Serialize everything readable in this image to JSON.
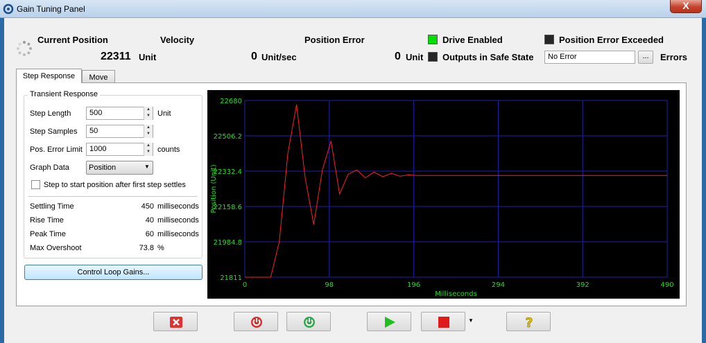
{
  "window": {
    "title": "Gain Tuning Panel",
    "close_label": "X"
  },
  "status": {
    "current_position_label": "Current Position",
    "current_position_value": "22311",
    "current_position_unit": "Unit",
    "velocity_label": "Velocity",
    "velocity_value": "0",
    "velocity_unit": "Unit/sec",
    "position_error_label": "Position Error",
    "position_error_value": "0",
    "position_error_unit": "Unit",
    "drive_enabled_label": "Drive Enabled",
    "drive_enabled_color": "#00e000",
    "safe_state_label": "Outputs in Safe State",
    "safe_state_color": "#262626",
    "pos_error_exceeded_label": "Position Error Exceeded",
    "pos_error_exceeded_color": "#262626",
    "errors_value": "No Error",
    "errors_browse_label": "...",
    "errors_label": "Errors"
  },
  "tabs": [
    {
      "label": "Step Response",
      "active": true
    },
    {
      "label": "Move",
      "active": false
    }
  ],
  "transient": {
    "group_title": "Transient Response",
    "step_length_label": "Step Length",
    "step_length_value": "500",
    "step_length_unit": "Unit",
    "step_samples_label": "Step Samples",
    "step_samples_value": "50",
    "pos_error_limit_label": "Pos. Error Limit",
    "pos_error_limit_value": "1000",
    "pos_error_limit_unit": "counts",
    "graph_data_label": "Graph Data",
    "graph_data_value": "Position",
    "checkbox_label": "Step to start position after first step settles",
    "checkbox_checked": false,
    "stats": [
      {
        "label": "Settling Time",
        "value": "450",
        "unit": "milliseconds"
      },
      {
        "label": "Rise Time",
        "value": "40",
        "unit": "milliseconds"
      },
      {
        "label": "Peak Time",
        "value": "60",
        "unit": "milliseconds"
      },
      {
        "label": "Max Overshoot",
        "value": "73.8",
        "unit": "%"
      }
    ],
    "gains_button_label": "Control Loop Gains..."
  },
  "chart_data": {
    "type": "line",
    "xlabel": "Milliseconds",
    "ylabel": "Position (Unit)",
    "xlim": [
      0,
      490
    ],
    "ylim": [
      21811,
      22680
    ],
    "x_ticks": [
      "0",
      "98",
      "196",
      "294",
      "392",
      "490"
    ],
    "y_ticks": [
      "22680",
      "22506.2",
      "22332.4",
      "22158.6",
      "21984.8",
      "21811"
    ],
    "grid": true,
    "colors": {
      "background": "#000000",
      "grid": "#1f1fb0",
      "line": "#ff2020",
      "text": "#20e020"
    },
    "series": [
      {
        "x": [
          0,
          10,
          20,
          30,
          40,
          50,
          60,
          70,
          80,
          90,
          100,
          110,
          120,
          130,
          140,
          150,
          160,
          170,
          180,
          190,
          200,
          250,
          300,
          350,
          400,
          450,
          490
        ],
        "values": [
          21811,
          21811,
          21811,
          21811,
          21985,
          22420,
          22660,
          22300,
          22070,
          22340,
          22480,
          22220,
          22318,
          22338,
          22300,
          22328,
          22305,
          22322,
          22308,
          22314,
          22311,
          22311,
          22311,
          22311,
          22311,
          22311,
          22311
        ]
      }
    ]
  },
  "toolbar": {
    "buttons": [
      {
        "name": "stop-disable-button",
        "icon": "red-x-icon"
      },
      {
        "name": "disable-drive-button",
        "icon": "power-off-icon"
      },
      {
        "name": "enable-drive-button",
        "icon": "power-on-icon"
      },
      {
        "name": "start-button",
        "icon": "play-icon"
      },
      {
        "name": "stop-button",
        "icon": "stop-icon"
      },
      {
        "name": "help-button",
        "icon": "help-icon"
      }
    ]
  }
}
